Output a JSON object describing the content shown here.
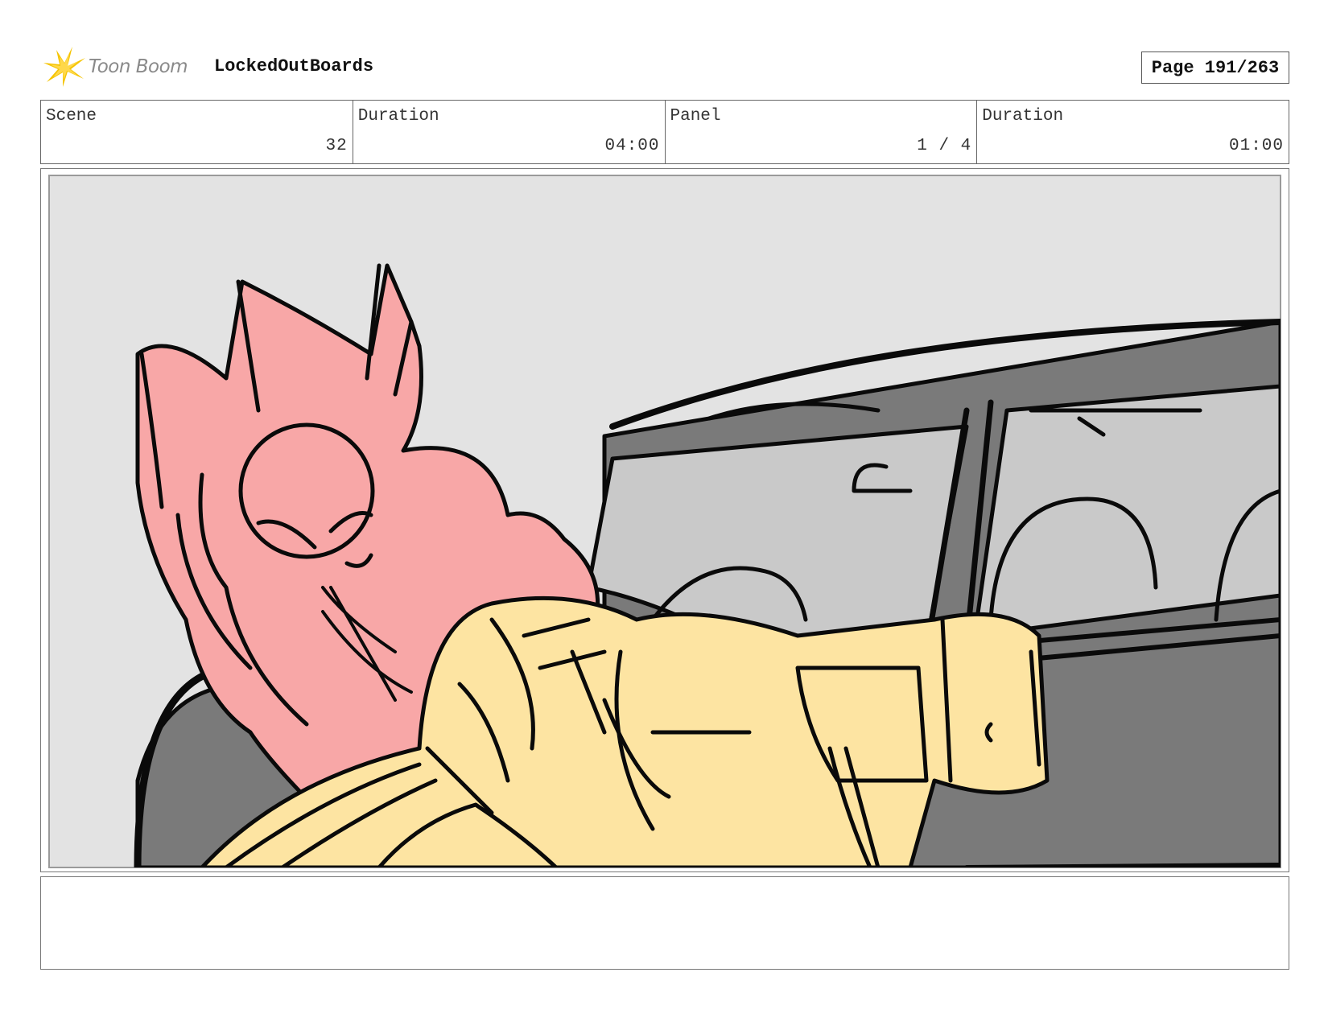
{
  "header": {
    "logo_text": "Toon Boom",
    "project": "LockedOutBoards",
    "page": "Page 191/263"
  },
  "info": {
    "scene_label": "Scene",
    "scene_value": "32",
    "scene_duration_label": "Duration",
    "scene_duration_value": "04:00",
    "panel_label": "Panel",
    "panel_value": "1 / 4",
    "panel_duration_label": "Duration",
    "panel_duration_value": "01:00"
  },
  "notes": {
    "text": ""
  },
  "colors": {
    "background_wall": "#e3e3e3",
    "car_body": "#7a7a7a",
    "car_window": "#c9c9c9",
    "pink_character": "#f8a7a7",
    "yellow_character": "#fde4a2",
    "ink": "#0a0a0a"
  }
}
